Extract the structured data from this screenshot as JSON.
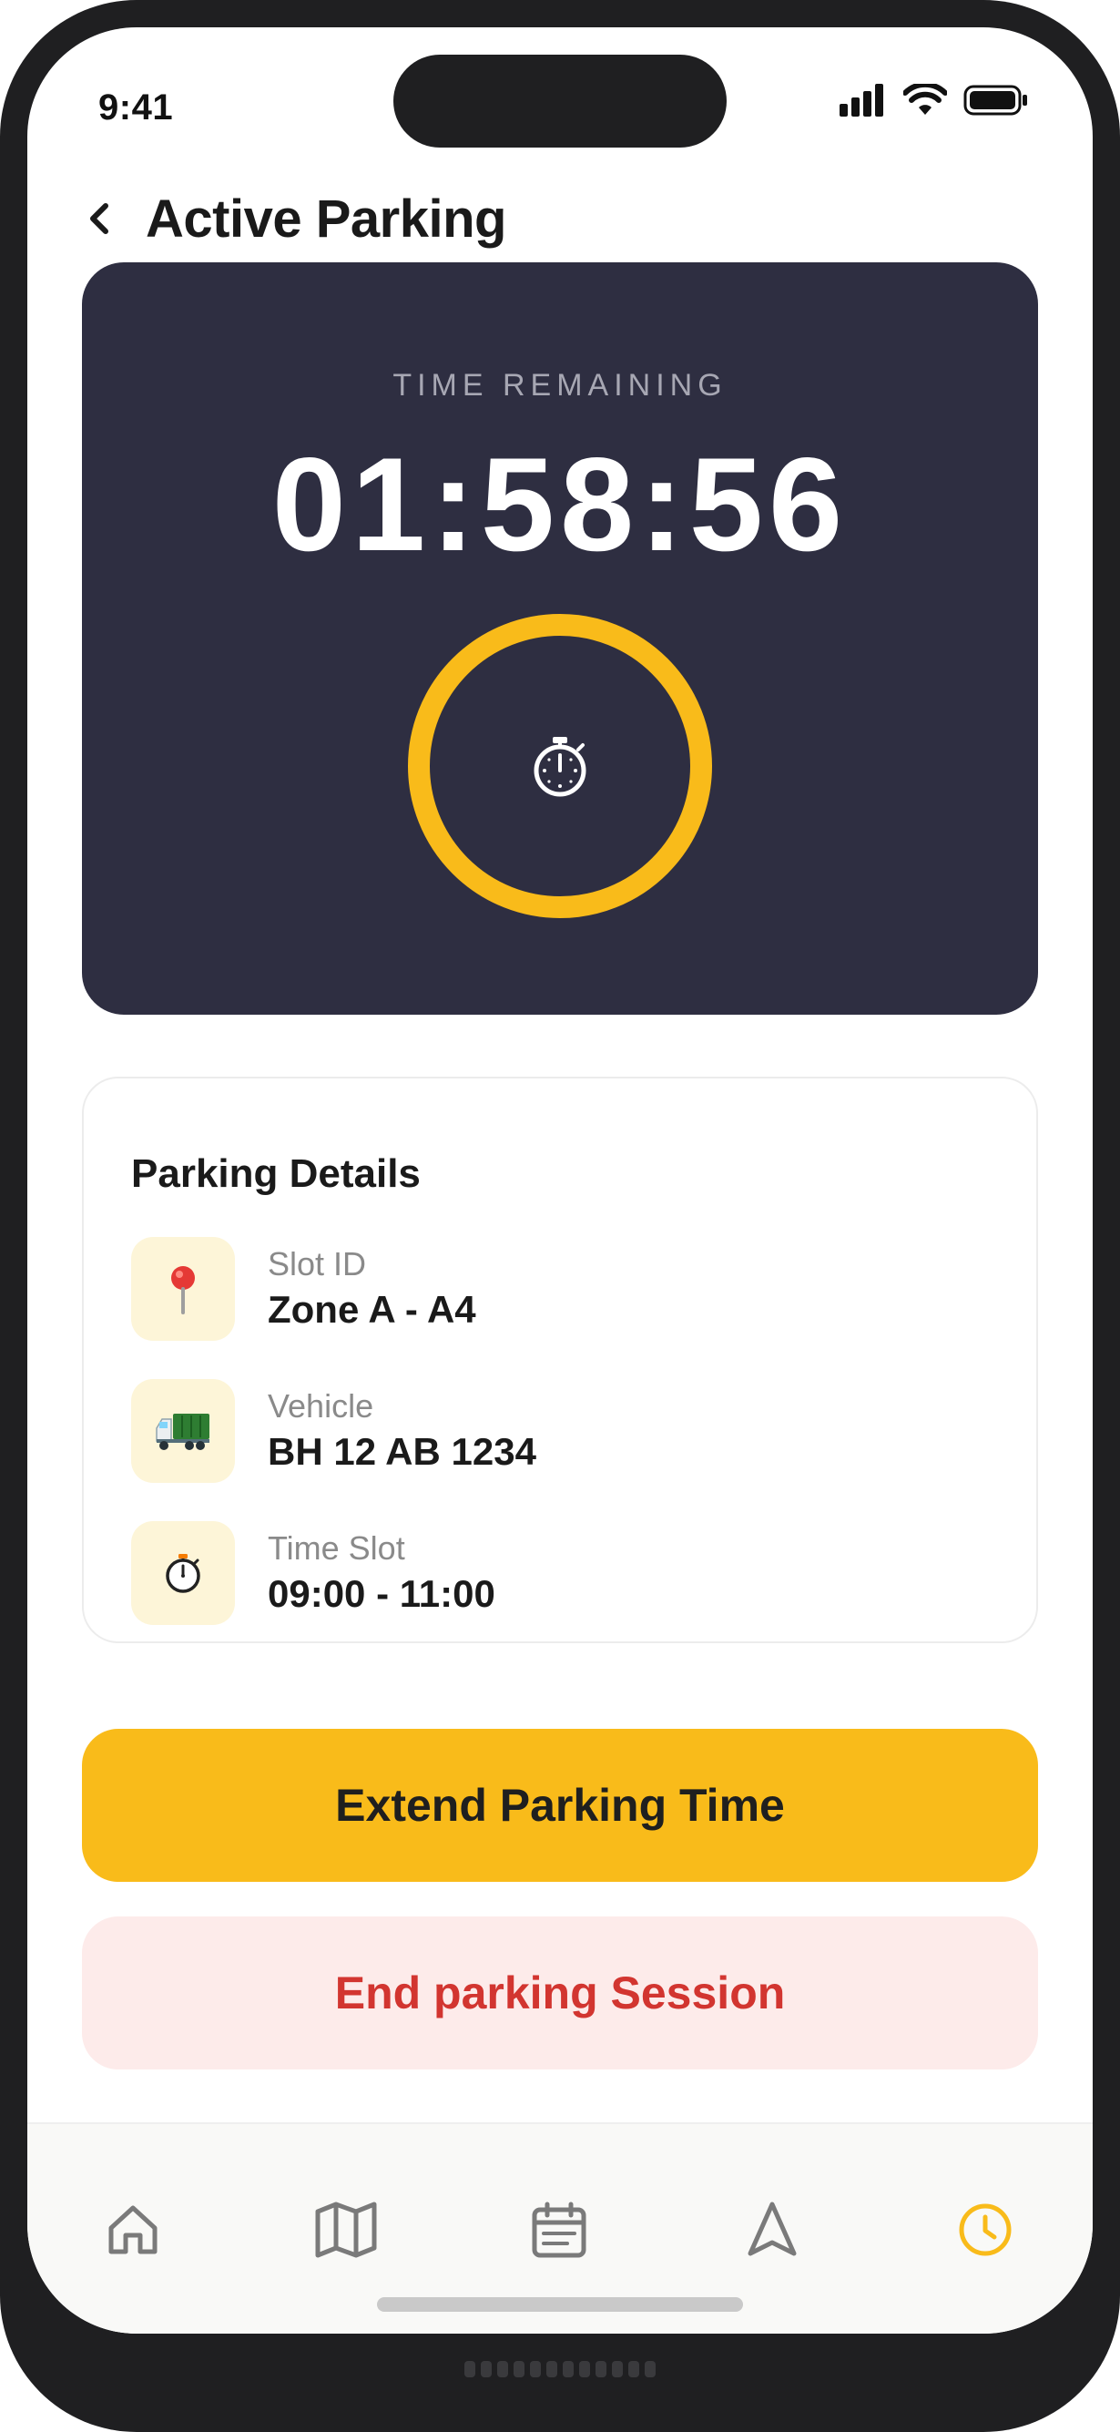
{
  "status_bar": {
    "time": "9:41"
  },
  "header": {
    "title": "Active Parking"
  },
  "timer": {
    "label": "TIME REMAINING",
    "value": "01:58:56",
    "ring_color": "#f9bb1a"
  },
  "details": {
    "title": "Parking Details",
    "rows": [
      {
        "icon": "pin-icon",
        "glyph": "📍",
        "label": "Slot ID",
        "value": "Zone A - A4"
      },
      {
        "icon": "truck-icon",
        "glyph": "🚛",
        "label": "Vehicle",
        "value": "BH 12 AB 1234"
      },
      {
        "icon": "stopwatch-icon",
        "glyph": "⏱",
        "label": "Time Slot",
        "value": "09:00 - 11:00"
      }
    ]
  },
  "actions": {
    "extend_label": "Extend Parking Time",
    "end_label": "End parking Session"
  },
  "tabbar": {
    "items": [
      "home-icon",
      "map-icon",
      "calendar-icon",
      "navigation-icon",
      "clock-icon"
    ],
    "active": "clock-icon",
    "active_color": "#f9bb1a",
    "inactive_color": "#7a7a7a"
  },
  "colors": {
    "card_dark": "#2e2e41",
    "accent": "#f9bb1a",
    "danger": "#d23530",
    "danger_bg": "#fdebea",
    "icon_bg": "#fdf5d8"
  }
}
